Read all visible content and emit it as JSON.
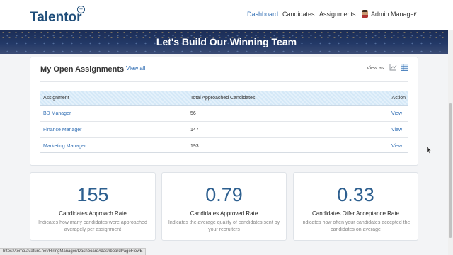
{
  "header": {
    "logo": "Talentor",
    "nav": [
      "Dashboard",
      "Candidates",
      "Assignments"
    ],
    "user": "Admin Manager"
  },
  "banner": {
    "title": "Let's Build Our Winning Team"
  },
  "assignments": {
    "title": "My Open Assignments",
    "view_all": "View all",
    "view_as": "View as:",
    "columns": [
      "Assignment",
      "Total Approached Candidates",
      "Action"
    ],
    "rows": [
      {
        "name": "BD Manager",
        "count": "56",
        "action": "View"
      },
      {
        "name": "Finance Manager",
        "count": "147",
        "action": "View"
      },
      {
        "name": "Marketing Manager",
        "count": "193",
        "action": "View"
      }
    ]
  },
  "stats": [
    {
      "value": "155",
      "label": "Candidates Approach Rate",
      "desc": "Indicates how many candidates were approached averagely per assignment"
    },
    {
      "value": "0.79",
      "label": "Candidates Approved Rate",
      "desc": "Indicates the average quality of candidates sent by your recruiters"
    },
    {
      "value": "0.33",
      "label": "Candidates Offer Acceptance Rate",
      "desc": "Indicates how often your candidates accepted the candidates on average"
    }
  ],
  "status_url": "https://temo.avature.net/HiringManager/Dashboard#dashboardPageFlowE",
  "colors": {
    "brand": "#1f4e7a",
    "link": "#2f6db3",
    "stat": "#2d5f8f",
    "banner": "#223866"
  }
}
